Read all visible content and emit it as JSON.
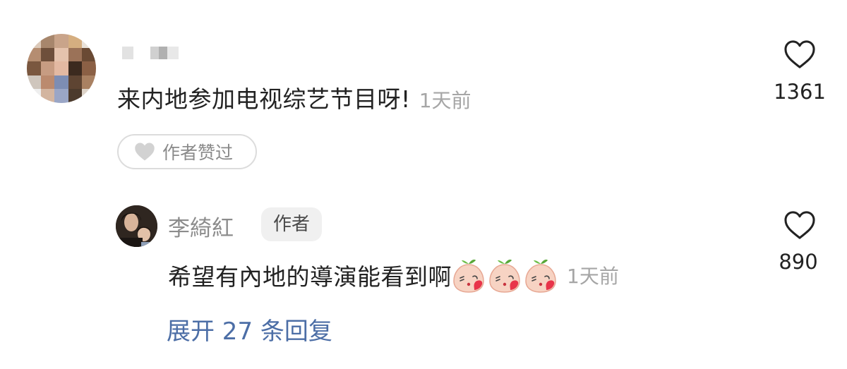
{
  "comment": {
    "text": "来内地参加电视综艺节目呀!",
    "time": "1天前",
    "author_liked_label": "作者赞过",
    "like_count": "1361",
    "icon": "heart-outline-icon"
  },
  "reply": {
    "username": "李綺紅",
    "badge": "作者",
    "text": "希望有內地的導演能看到啊",
    "emoji_count": 3,
    "emoji_icon": "peach-blowing-kiss-icon",
    "time": "1天前",
    "like_count": "890",
    "icon": "heart-outline-icon"
  },
  "expand_replies": "展开 27 条回复",
  "colors": {
    "text_primary": "#222222",
    "text_secondary": "#8c8c8c",
    "time": "#a6a6a6",
    "link": "#4c6ea6",
    "badge_bg": "#f0f0f0",
    "pill_border": "#dcdcdc"
  }
}
